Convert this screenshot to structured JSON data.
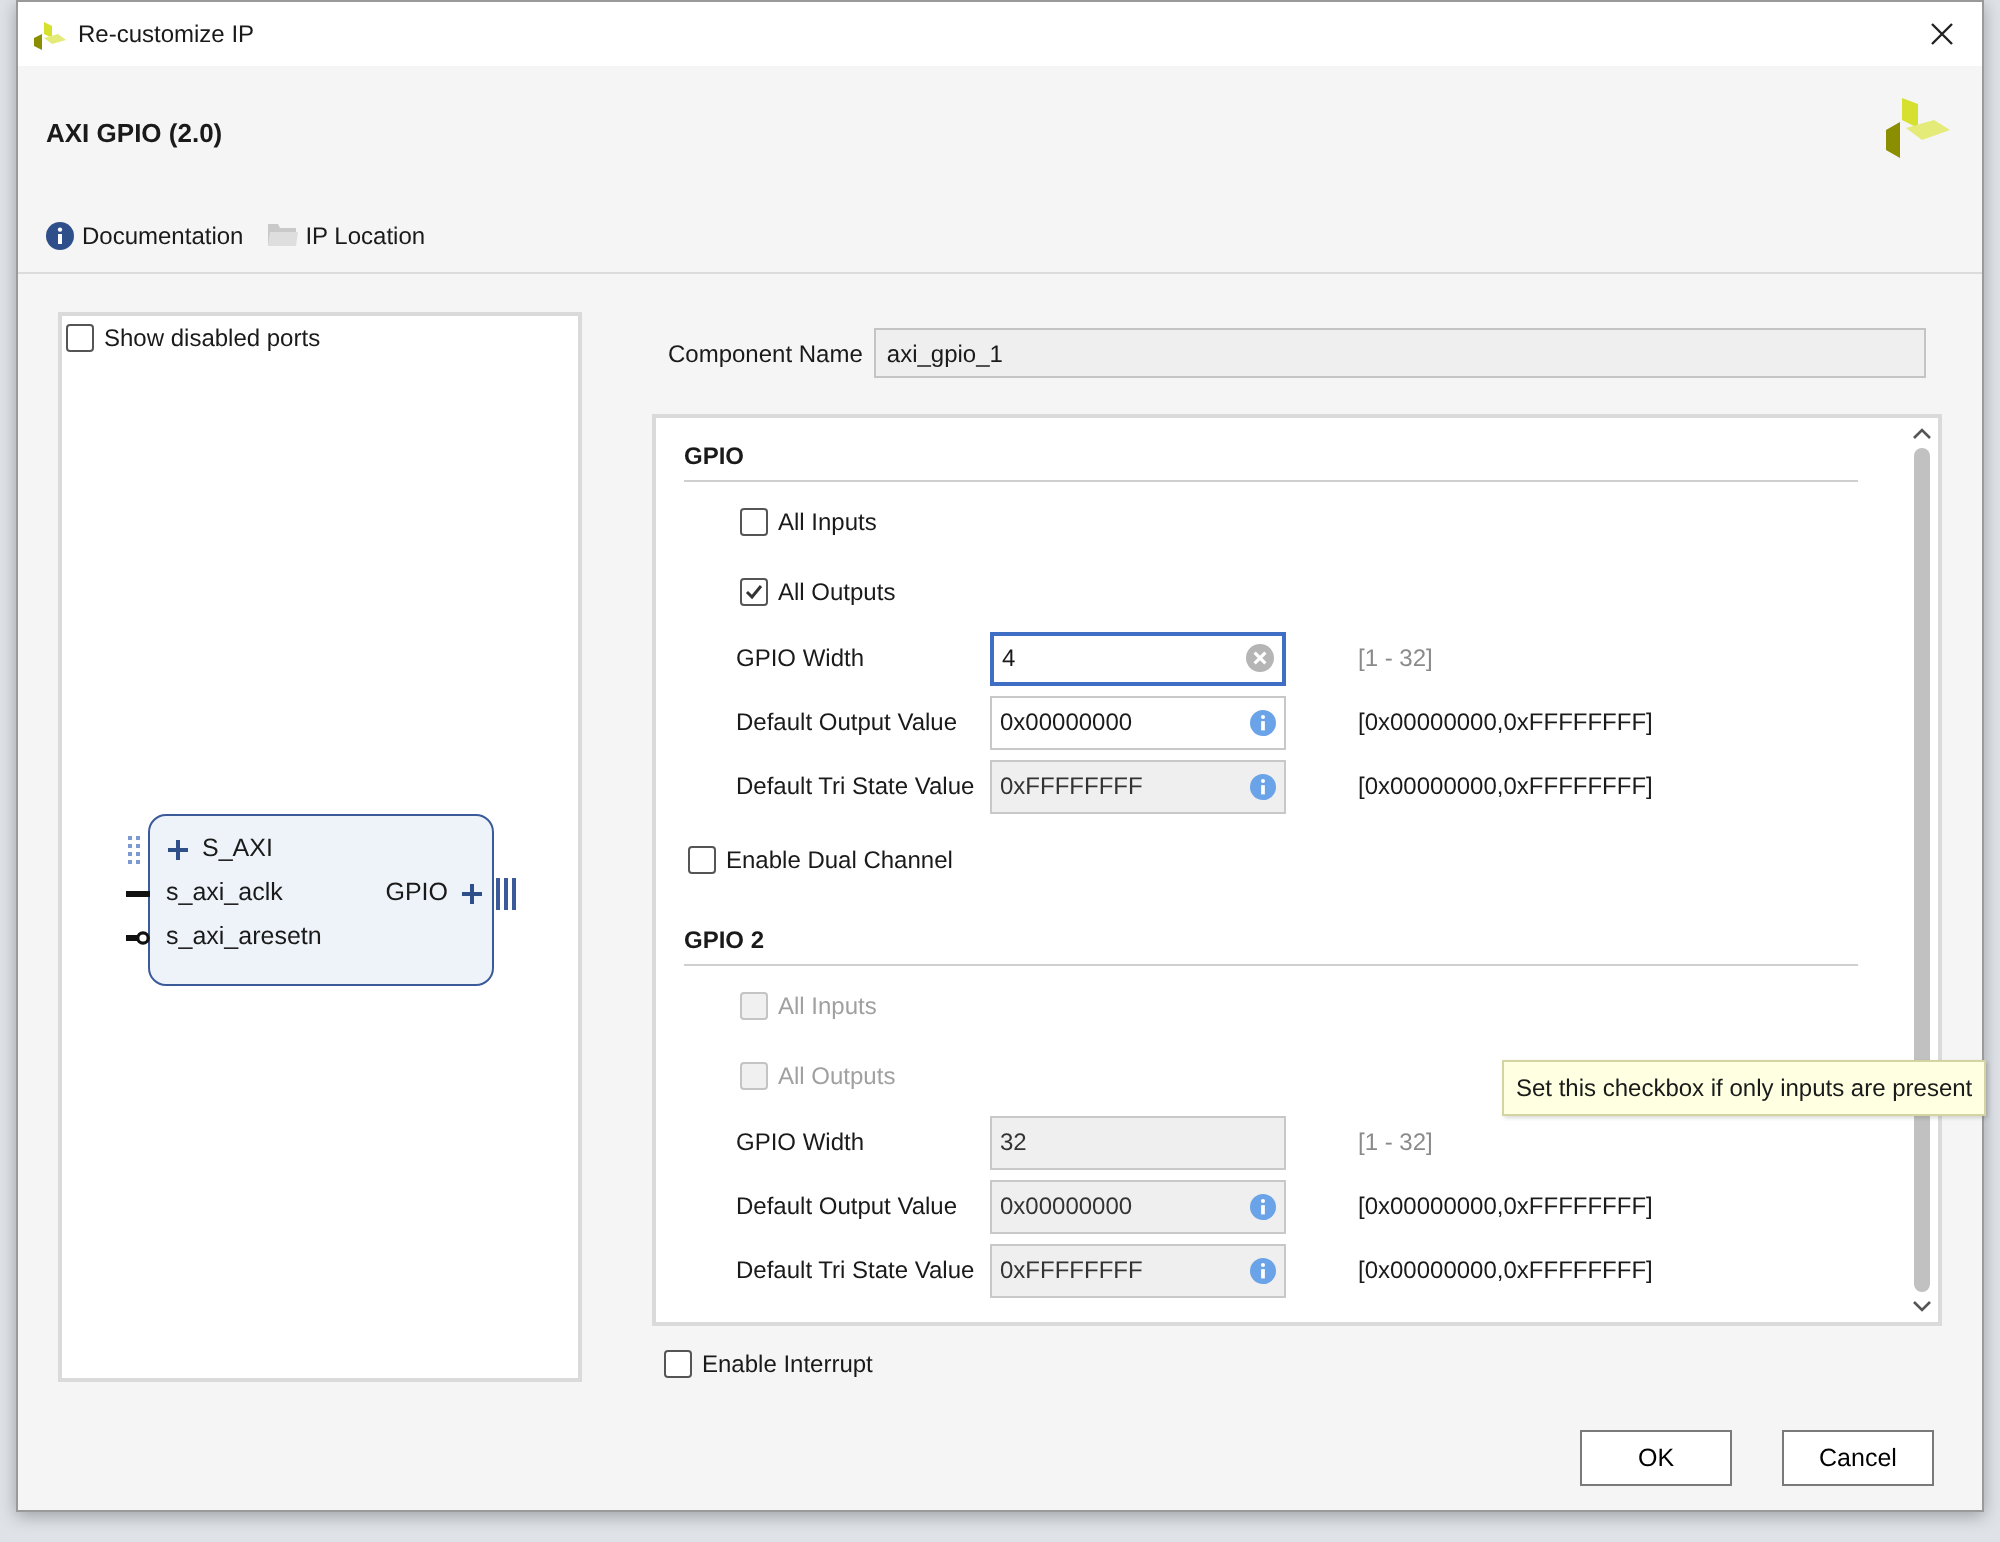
{
  "window": {
    "title": "Re-customize IP"
  },
  "header": {
    "title": "AXI GPIO (2.0)",
    "links": [
      {
        "label": "Documentation",
        "kind": "info"
      },
      {
        "label": "IP Location",
        "kind": "folder"
      }
    ]
  },
  "preview": {
    "show_disabled_ports": {
      "label": "Show disabled ports",
      "checked": false
    },
    "left_ports": [
      {
        "label": "S_AXI",
        "kind": "bus"
      },
      {
        "label": "s_axi_aclk",
        "kind": "clock"
      },
      {
        "label": "s_axi_aresetn",
        "kind": "reset"
      }
    ],
    "right_ports": [
      {
        "label": "GPIO",
        "kind": "bus"
      }
    ]
  },
  "component_name": {
    "label": "Component Name",
    "value": "axi_gpio_1"
  },
  "settings": [
    {
      "kind": "heading",
      "label": "GPIO"
    },
    {
      "kind": "checkbox",
      "label": "All Inputs",
      "checked": false,
      "disabled": false
    },
    {
      "kind": "checkbox",
      "label": "All Outputs",
      "checked": true,
      "disabled": false
    },
    {
      "kind": "number",
      "label": "GPIO Width",
      "value": "4",
      "disabled": false,
      "focused": true,
      "range": "[1 - 32]"
    },
    {
      "kind": "hex",
      "label": "Default Output Value",
      "value": "0x00000000",
      "disabled": false,
      "focused": false,
      "range": "[0x00000000,0xFFFFFFFF]"
    },
    {
      "kind": "hex",
      "label": "Default Tri State Value",
      "value": "0xFFFFFFFF",
      "disabled": true,
      "focused": false,
      "range": "[0x00000000,0xFFFFFFFF]"
    },
    {
      "kind": "option",
      "label": "Enable Dual Channel",
      "checked": false,
      "disabled": false
    },
    {
      "kind": "heading",
      "label": "GPIO 2"
    },
    {
      "kind": "checkbox",
      "label": "All Inputs",
      "checked": false,
      "disabled": true
    },
    {
      "kind": "checkbox",
      "label": "All Outputs",
      "checked": false,
      "disabled": true
    },
    {
      "kind": "number",
      "label": "GPIO Width",
      "value": "32",
      "disabled": true,
      "focused": false,
      "range": "[1 - 32]"
    },
    {
      "kind": "hex",
      "label": "Default Output Value",
      "value": "0x00000000",
      "disabled": true,
      "focused": false,
      "range": "[0x00000000,0xFFFFFFFF]"
    },
    {
      "kind": "hex",
      "label": "Default Tri State Value",
      "value": "0xFFFFFFFF",
      "disabled": true,
      "focused": false,
      "range": "[0x00000000,0xFFFFFFFF]"
    }
  ],
  "enable_interrupt": {
    "label": "Enable Interrupt",
    "checked": false
  },
  "tooltip": "Set this checkbox if only inputs are present",
  "buttons": [
    "OK",
    "Cancel"
  ]
}
